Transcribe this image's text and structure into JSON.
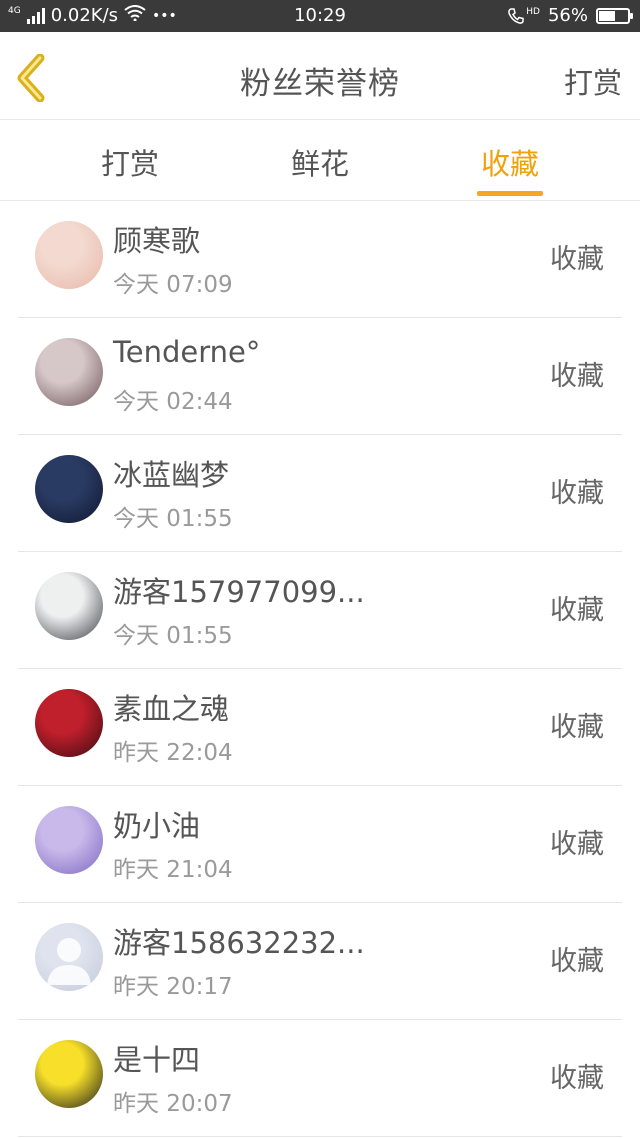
{
  "status_bar": {
    "network_type": "4G",
    "speed": "0.02K/s",
    "dots": "•••",
    "time": "10:29",
    "hd": "HD",
    "battery": "56%",
    "battery_level": 0.56
  },
  "header": {
    "title": "粉丝荣誉榜",
    "right_action": "打赏"
  },
  "tabs": [
    {
      "label": "打赏"
    },
    {
      "label": "鲜花"
    },
    {
      "label": "收藏"
    }
  ],
  "active_tab": 2,
  "list": [
    {
      "name": "顾寒歌",
      "time": "今天 07:09",
      "action": "收藏",
      "avatar_colors": [
        "#f3d9cf",
        "#e8b7a8"
      ]
    },
    {
      "name": "Tenderne°",
      "time": "今天 02:44",
      "action": "收藏",
      "avatar_colors": [
        "#d6c7c9",
        "#6e5356"
      ]
    },
    {
      "name": "冰蓝幽梦",
      "time": "今天 01:55",
      "action": "收藏",
      "avatar_colors": [
        "#2a3b63",
        "#0f1730"
      ]
    },
    {
      "name": "游客157977099...",
      "time": "今天 01:55",
      "action": "收藏",
      "avatar_colors": [
        "#eef0f0",
        "#3a3d44"
      ]
    },
    {
      "name": "素血之魂",
      "time": "昨天 22:04",
      "action": "收藏",
      "avatar_colors": [
        "#c01f2c",
        "#3a0b10"
      ]
    },
    {
      "name": "奶小油",
      "time": "昨天 21:04",
      "action": "收藏",
      "avatar_colors": [
        "#c9b8ea",
        "#7d67c2"
      ]
    },
    {
      "name": "游客158632232...",
      "time": "昨天 20:17",
      "action": "收藏",
      "avatar_colors": [
        "#dfe3ee",
        "#c3c9d9"
      ]
    },
    {
      "name": "是十四",
      "time": "昨天 20:07",
      "action": "收藏",
      "avatar_colors": [
        "#f7df2a",
        "#1b1b1b"
      ]
    }
  ],
  "colors": {
    "accent": "#f5a623",
    "status_bar": "#3a3a3a"
  }
}
